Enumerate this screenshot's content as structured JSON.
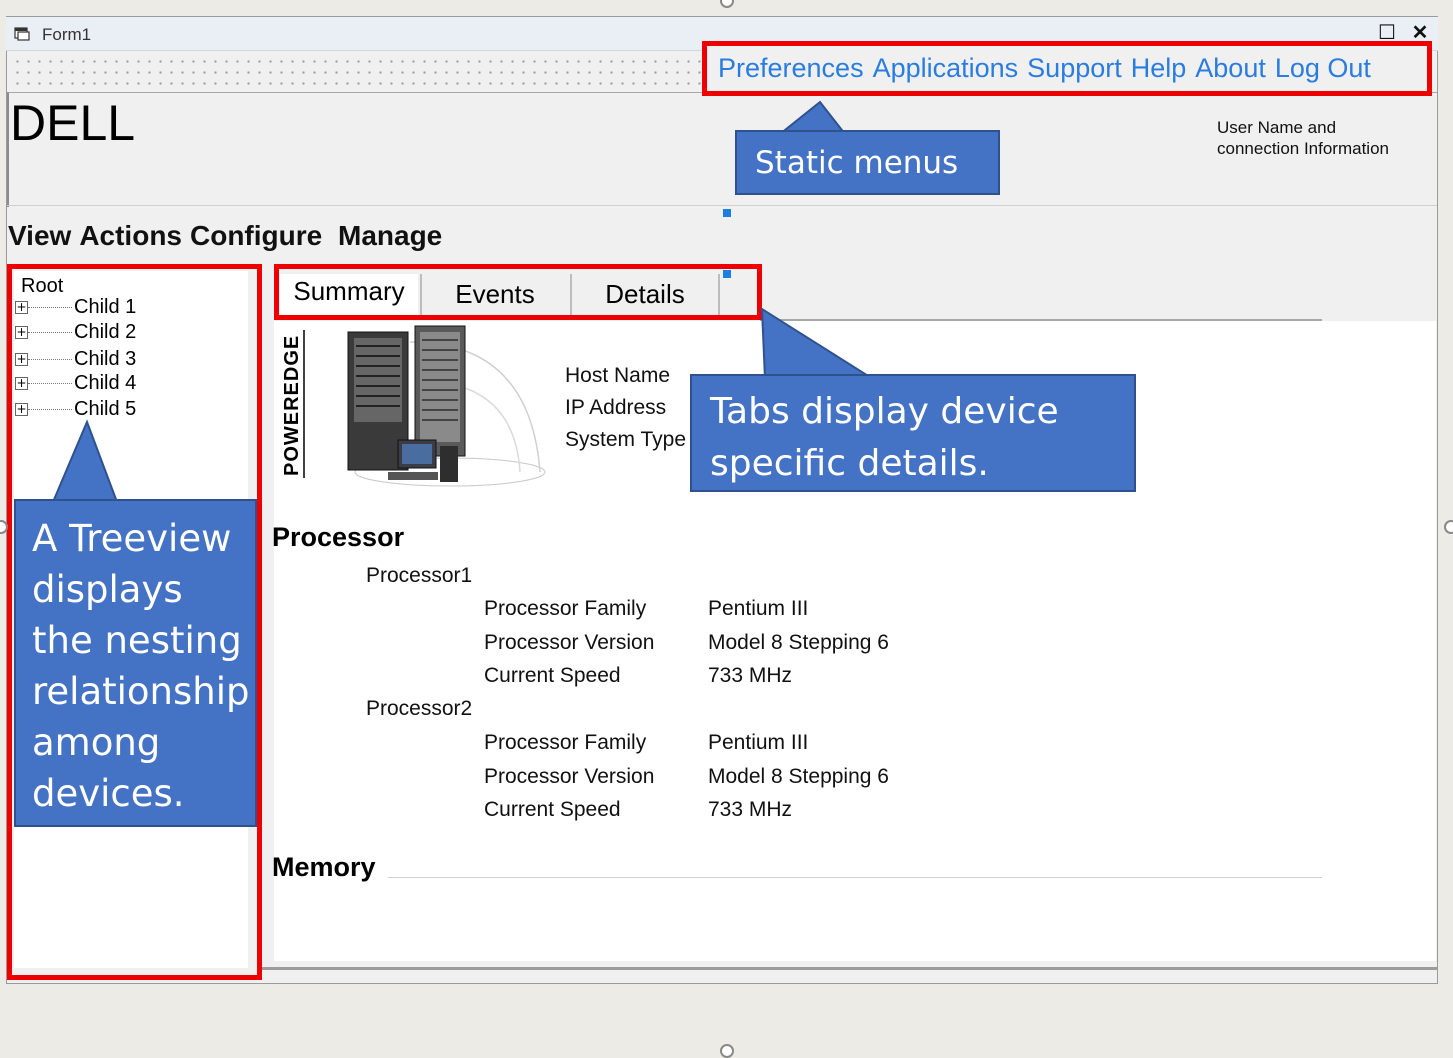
{
  "window": {
    "title": "Form1",
    "minimize": "_",
    "maximize": "☐",
    "close": "✕"
  },
  "static_menu": {
    "items": [
      "Preferences",
      "Applications",
      "Support",
      "Help",
      "About",
      "Log Out"
    ]
  },
  "header": {
    "brand": "DELL",
    "user_info": "User Name and connection Information"
  },
  "main_menu": {
    "items": [
      "View",
      "Actions",
      "Configure",
      "Manage"
    ]
  },
  "tree": {
    "root": "Root",
    "children": [
      "Child 1",
      "Child 2",
      "Child 3",
      "Child 4",
      "Child 5"
    ]
  },
  "tabs": [
    "Summary",
    "Events",
    "Details"
  ],
  "device": {
    "image_label": "POWEREDGE",
    "fields": [
      "Host Name",
      "IP Address",
      "System Type"
    ]
  },
  "processor": {
    "heading": "Processor",
    "items": [
      {
        "name": "Processor1",
        "props": [
          {
            "label": "Processor Family",
            "value": "Pentium III"
          },
          {
            "label": "Processor Version",
            "value": "Model 8 Stepping 6"
          },
          {
            "label": "Current Speed",
            "value": "733 MHz"
          }
        ]
      },
      {
        "name": "Processor2",
        "props": [
          {
            "label": "Processor Family",
            "value": "Pentium III"
          },
          {
            "label": "Processor Version",
            "value": "Model 8 Stepping 6"
          },
          {
            "label": "Current Speed",
            "value": "733 MHz"
          }
        ]
      }
    ]
  },
  "memory": {
    "heading": "Memory"
  },
  "callouts": {
    "static": "Static menus",
    "tabs": "Tabs display device specific details.",
    "tree": "A Treeview displays the nesting relationship among devices."
  },
  "colors": {
    "accent_link": "#2a7de0",
    "highlight_border": "#ee0000",
    "callout_bg": "#4472c4"
  },
  "icons": [
    "form-icon",
    "minimize-icon",
    "maximize-icon",
    "close-icon",
    "expand-icon",
    "server-image"
  ]
}
